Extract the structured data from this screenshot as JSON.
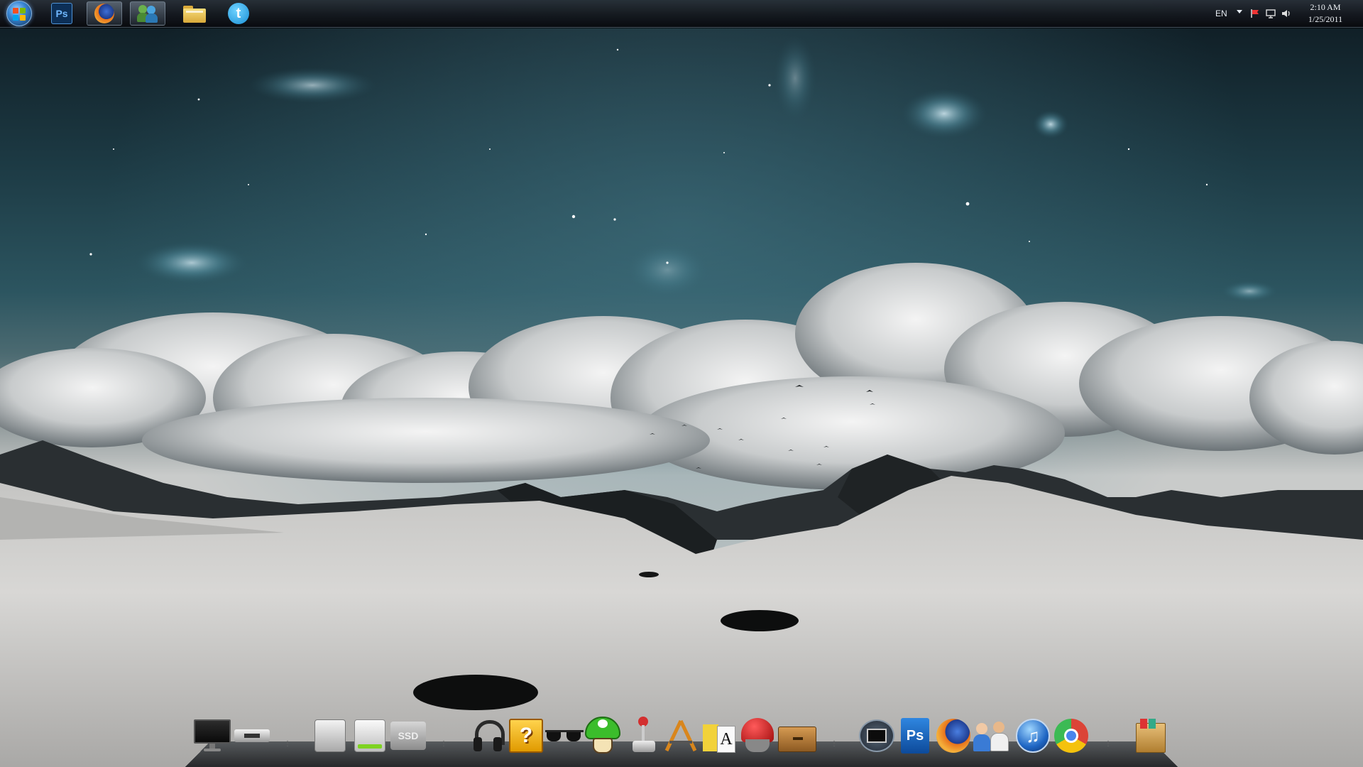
{
  "desktop": {
    "wallpaper": "night-sky-clouds-snow-mountains"
  },
  "taskbar": {
    "start_button": "windows-start-orb",
    "pinned": [
      {
        "name": "photoshop",
        "icon": "photoshop-icon",
        "label": "Ps",
        "active": false
      },
      {
        "name": "firefox",
        "icon": "firefox-icon",
        "active": true
      },
      {
        "name": "messenger",
        "icon": "messenger-icon",
        "active": true
      },
      {
        "name": "explorer",
        "icon": "folder-icon",
        "active": false
      },
      {
        "name": "twitter",
        "icon": "twitter-icon",
        "label": "t",
        "active": false
      }
    ],
    "tray": {
      "language": "EN",
      "icons": [
        "show-hidden-arrow-icon",
        "action-center-flag-icon",
        "network-icon",
        "volume-icon"
      ],
      "time": "2:10 AM",
      "date": "1/25/2011"
    }
  },
  "dock": {
    "groups": [
      [
        "monitor-icon",
        "usb-drive-icon"
      ],
      [
        "hard-drive-icon",
        "green-drive-icon",
        "ssd-drive-icon"
      ],
      [
        "headphones-icon",
        "question-block-icon",
        "sunglasses-icon",
        "mushroom-icon",
        "joystick-icon",
        "applications-icon",
        "font-book-icon",
        "red-cap-icon",
        "drawer-icon"
      ],
      [
        "screen-capture-icon",
        "photoshop-icon",
        "firefox-icon",
        "users-icon",
        "itunes-icon",
        "chrome-icon"
      ],
      [
        "archive-box-icon"
      ]
    ],
    "ssd_label": "SSD",
    "ps_label": "Ps",
    "colors": {
      "photoshop": "#1a63b5",
      "firefox": "#e8731c",
      "chrome_red": "#db4437",
      "chrome_yellow": "#f4c20d",
      "chrome_green": "#3cba54",
      "chrome_blue": "#4885ed",
      "mushroom": "#3bbd2b",
      "question_block": "#f2b619"
    }
  }
}
